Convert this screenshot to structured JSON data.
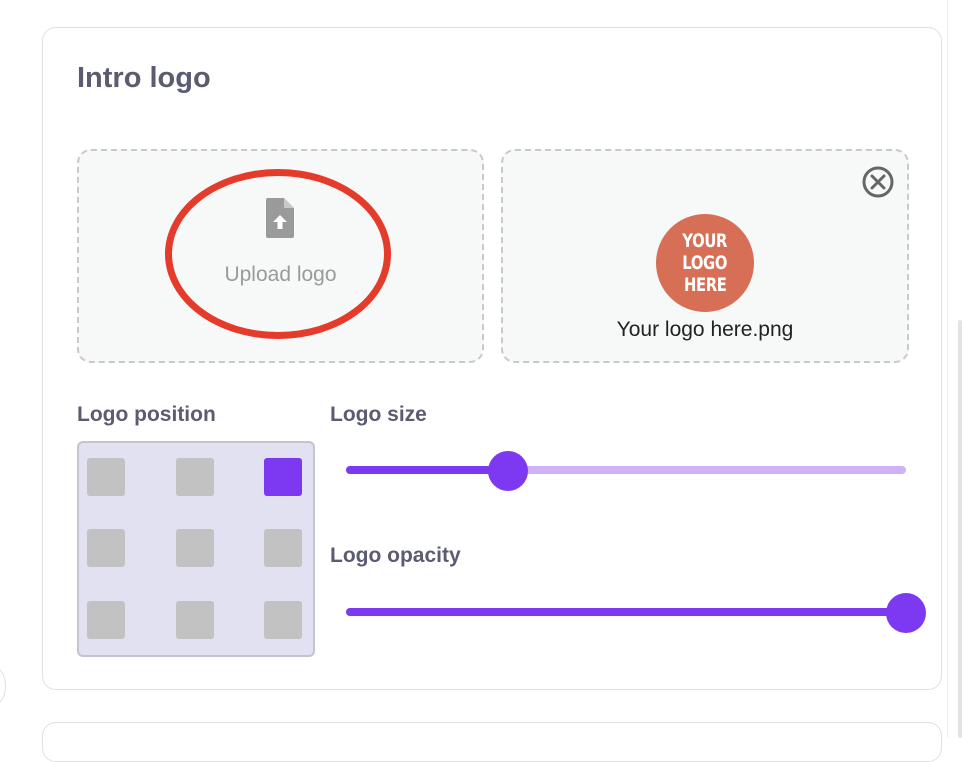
{
  "section": {
    "title": "Intro logo"
  },
  "upload": {
    "label": "Upload logo",
    "icon": "file-upload-icon"
  },
  "preview": {
    "logo_text": [
      "YOUR",
      "LOGO",
      "HERE"
    ],
    "file_name": "Your logo here.png",
    "remove_icon": "close-circle-icon"
  },
  "position": {
    "label": "Logo position",
    "selected": "top-right",
    "cells": [
      "top-left",
      "top-center",
      "top-right",
      "middle-left",
      "middle-center",
      "middle-right",
      "bottom-left",
      "bottom-center",
      "bottom-right"
    ]
  },
  "size": {
    "label": "Logo size",
    "value": 0.29
  },
  "opacity": {
    "label": "Logo opacity",
    "value": 1.0
  },
  "colors": {
    "accent": "#7c39f1",
    "accent_light": "#cfb3f6",
    "annotation": "#e43b2b",
    "logo_badge": "#d66f55"
  }
}
